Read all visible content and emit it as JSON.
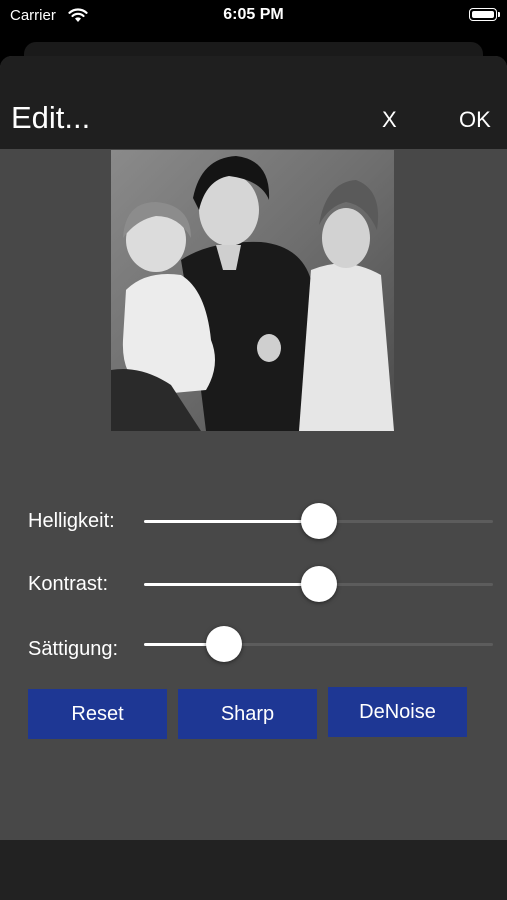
{
  "status_bar": {
    "carrier": "Carrier",
    "time": "6:05 PM"
  },
  "nav": {
    "title": "Edit...",
    "close_label": "X",
    "ok_label": "OK"
  },
  "photo": {
    "icon": "family-portrait-photo"
  },
  "sliders": [
    {
      "label": "Helligkeit:",
      "value": 0.5
    },
    {
      "label": "Kontrast:",
      "value": 0.5
    },
    {
      "label": "Sättigung:",
      "value": 0.23
    }
  ],
  "buttons": {
    "reset": "Reset",
    "sharp": "Sharp",
    "denoise": "DeNoise"
  },
  "colors": {
    "button": "#1e3794",
    "panel": "#484848",
    "nav": "#1f1f1f"
  }
}
